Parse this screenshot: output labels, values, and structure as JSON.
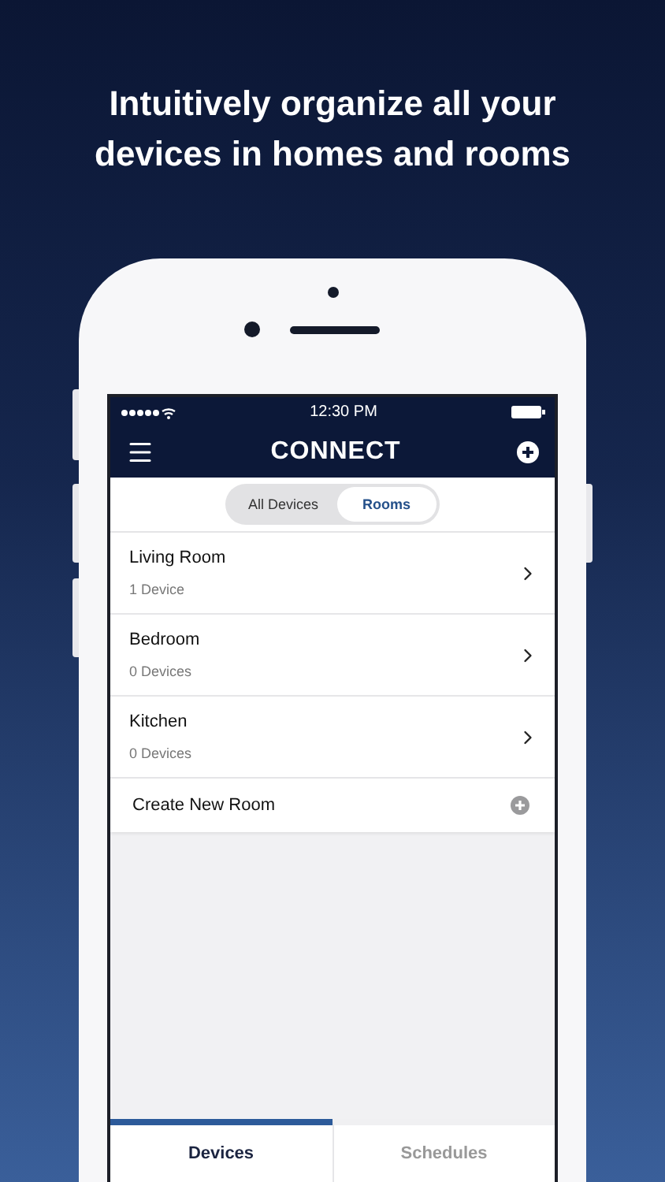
{
  "headline": "Intuitively organize all your devices in homes and rooms",
  "status_bar": {
    "time": "12:30 PM"
  },
  "nav": {
    "logo": "CONNECT"
  },
  "segments": [
    {
      "label": "All Devices",
      "selected": false
    },
    {
      "label": "Rooms",
      "selected": true
    }
  ],
  "rooms": [
    {
      "name": "Living Room",
      "count": "1 Device"
    },
    {
      "name": "Bedroom",
      "count": "0 Devices"
    },
    {
      "name": "Kitchen",
      "count": "0 Devices"
    }
  ],
  "create_row": {
    "label": "Create New Room"
  },
  "tabs": [
    {
      "label": "Devices",
      "selected": true
    },
    {
      "label": "Schedules",
      "selected": false
    }
  ]
}
